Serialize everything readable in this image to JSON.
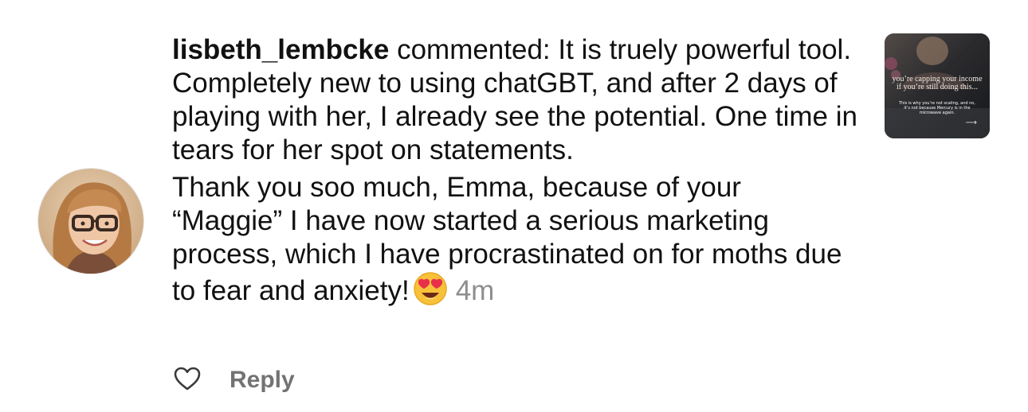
{
  "comment": {
    "username": "lisbeth_lembcke",
    "action_text": " commented: ",
    "paragraph_1": "It is truely powerful tool. Completely new to using chatGBT, and after 2 days of playing with her, I already see the potential. One time in tears for her spot on statements.",
    "paragraph_2": "Thank you soo much, Emma, because of your “Maggie” I have now started a serious marketing process, which I have procrastinated on for moths due to fear and anxiety!",
    "emoji_icon": "heart-eyes-emoji-icon",
    "timestamp": "4m"
  },
  "actions": {
    "like_icon": "heart-outline-icon",
    "reply_label": "Reply"
  },
  "post_thumbnail": {
    "headline_line_1": "you’re capping your income",
    "headline_line_2": "if you’re still doing this...",
    "subtext": "This is why you’re not scaling, and no, it’s not because Mercury is in the microwave again.",
    "arrow": "⟶"
  },
  "colors": {
    "text": "#111111",
    "muted": "#8e8e8e",
    "reply": "#737373",
    "emoji_yellow": "#f7c23a",
    "emoji_heart": "#e8304b"
  }
}
